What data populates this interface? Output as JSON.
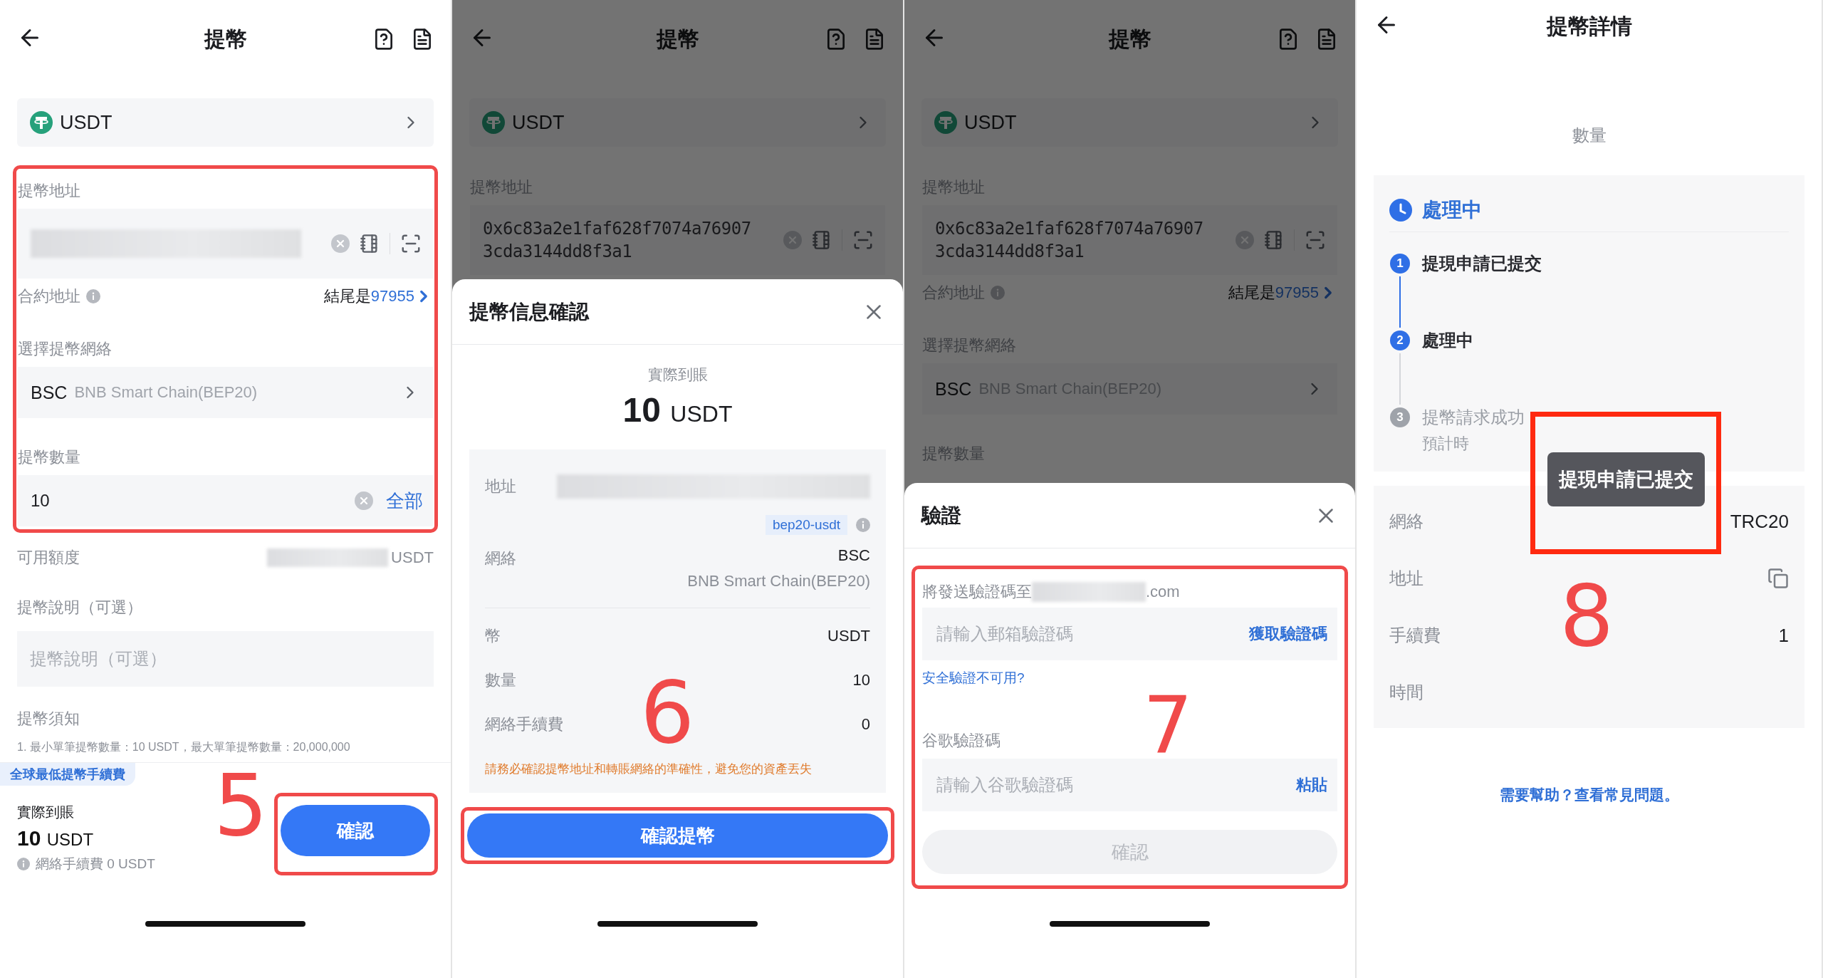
{
  "withdraw_screen": {
    "title": "提幣",
    "coin": "USDT",
    "address_label": "提幣地址",
    "contract_label": "合約地址",
    "contract_prefix": "結尾是",
    "contract_suffix": "97955",
    "network_label": "選擇提幣網絡",
    "network_code": "BSC",
    "network_name": "BNB Smart Chain(BEP20)",
    "amount_label": "提幣數量",
    "amount_value": "10",
    "amount_all": "全部",
    "available_label": "可用額度",
    "available_unit": "USDT",
    "memo_label": "提幣說明（可選）",
    "memo_placeholder": "提幣說明（可選）",
    "notice_label": "提幣須知",
    "notice_text": "1. 最小單筆提幣數量：10 USDT，最大單筆提幣數量：20,000,000",
    "badge": "全球最低提幣手續費",
    "received_label": "實際到賬",
    "received_amount": "10",
    "received_unit": "USDT",
    "fee_text": "網絡手續費 0 USDT",
    "confirm_button": "確認",
    "annotation_step": "5"
  },
  "confirm_screen": {
    "background": {
      "title": "提幣",
      "coin": "USDT",
      "address_label": "提幣地址",
      "address_lines": [
        "0x6c83a2e1faf628f7074a76907",
        "3cda3144dd8f3a1"
      ]
    },
    "sheet": {
      "title": "提幣信息確認",
      "received_label": "實際到賬",
      "received_amount": "10",
      "received_unit": "USDT",
      "address_label": "地址",
      "address_tag": "bep20-usdt",
      "network_label": "網絡",
      "network_code": "BSC",
      "network_name": "BNB Smart Chain(BEP20)",
      "rows": [
        {
          "label": "幣",
          "value": "USDT"
        },
        {
          "label": "數量",
          "value": "10"
        },
        {
          "label": "網絡手續費",
          "value": "0"
        }
      ],
      "warning": "請務必確認提幣地址和轉賬網絡的準確性，避免您的資產丟失",
      "submit_button": "確認提幣",
      "annotation_step": "6"
    }
  },
  "verify_screen": {
    "background": {
      "title": "提幣",
      "coin": "USDT",
      "address_label": "提幣地址",
      "address_lines": [
        "0x6c83a2e1faf628f7074a76907",
        "3cda3144dd8f3a1"
      ],
      "contract_label": "合約地址",
      "contract_prefix": "結尾是",
      "contract_suffix": "97955",
      "network_label": "選擇提幣網絡",
      "network_code": "BSC",
      "network_name": "BNB Smart Chain(BEP20)",
      "amount_label": "提幣數量"
    },
    "sheet": {
      "title": "驗證",
      "email_prefix": "將發送驗證碼至",
      "email_suffix": ".com",
      "email_placeholder": "請輸入郵箱驗證碼",
      "get_code": "獲取驗證碼",
      "unavailable_link": "安全驗證不可用?",
      "google_label": "谷歌驗證碼",
      "google_placeholder": "請輸入谷歌驗證碼",
      "paste": "粘貼",
      "confirm_button": "確認",
      "confirm_disabled": true,
      "annotation_step": "7"
    }
  },
  "detail_screen": {
    "title": "提幣詳情",
    "amount_label": "數量",
    "status": "處理中",
    "steps": [
      {
        "number": "1",
        "label": "提現申請已提交",
        "done": true
      },
      {
        "number": "2",
        "label": "處理中",
        "done": true
      },
      {
        "number": "3",
        "label": "提幣請求成功",
        "sub": "預計時",
        "done": false
      }
    ],
    "rows": [
      {
        "kind": "text",
        "label": "網絡",
        "value": "TRC20"
      },
      {
        "kind": "copy",
        "label": "地址"
      },
      {
        "kind": "text",
        "label": "手續費",
        "value": "1"
      },
      {
        "kind": "text",
        "label": "時間"
      }
    ],
    "toast": "提現申請已提交",
    "help_link": "需要幫助？查看常見問題。",
    "annotation_step": "8"
  }
}
